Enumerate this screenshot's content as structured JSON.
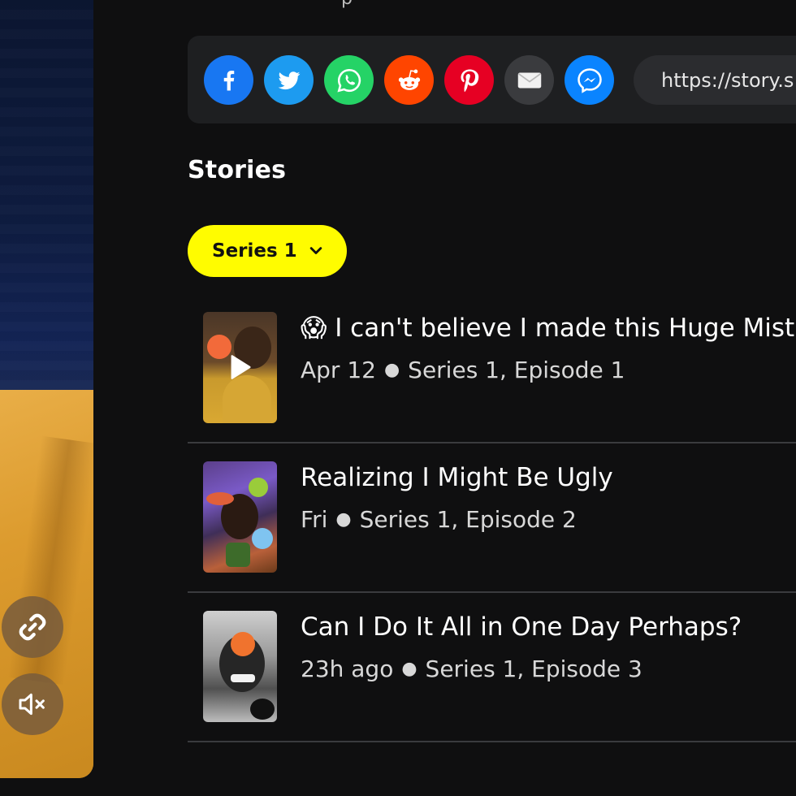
{
  "top_partial_text": "p",
  "share": {
    "buttons": [
      {
        "name": "facebook",
        "color": "#1877f2"
      },
      {
        "name": "twitter",
        "color": "#1d9bf0"
      },
      {
        "name": "whatsapp",
        "color": "#25d366"
      },
      {
        "name": "reddit",
        "color": "#ff4500"
      },
      {
        "name": "pinterest",
        "color": "#e60023"
      },
      {
        "name": "email",
        "color": "#3a3b3e"
      },
      {
        "name": "messenger",
        "color": "#0a84ff"
      }
    ],
    "url_text": "https://story.s"
  },
  "section_title": "Stories",
  "series_dropdown": {
    "label": "Series 1"
  },
  "stories": [
    {
      "emoji": "😱",
      "title": "I can't believe I made this Huge Mist",
      "date": "Apr 12",
      "episode": "Series 1, Episode 1",
      "playing": true
    },
    {
      "emoji": "",
      "title": "Realizing I Might Be Ugly",
      "date": "Fri",
      "episode": "Series 1, Episode 2",
      "playing": false
    },
    {
      "emoji": "",
      "title": "Can I Do It All in One Day Perhaps?",
      "date": "23h ago",
      "episode": "Series 1, Episode 3",
      "playing": false
    }
  ],
  "controls": {
    "link": "link-icon",
    "mute": "mute-icon"
  },
  "colors": {
    "accent": "#fffc00",
    "background": "#0f0f10",
    "panel": "#1e1f21",
    "divider": "#3a3b3e"
  }
}
